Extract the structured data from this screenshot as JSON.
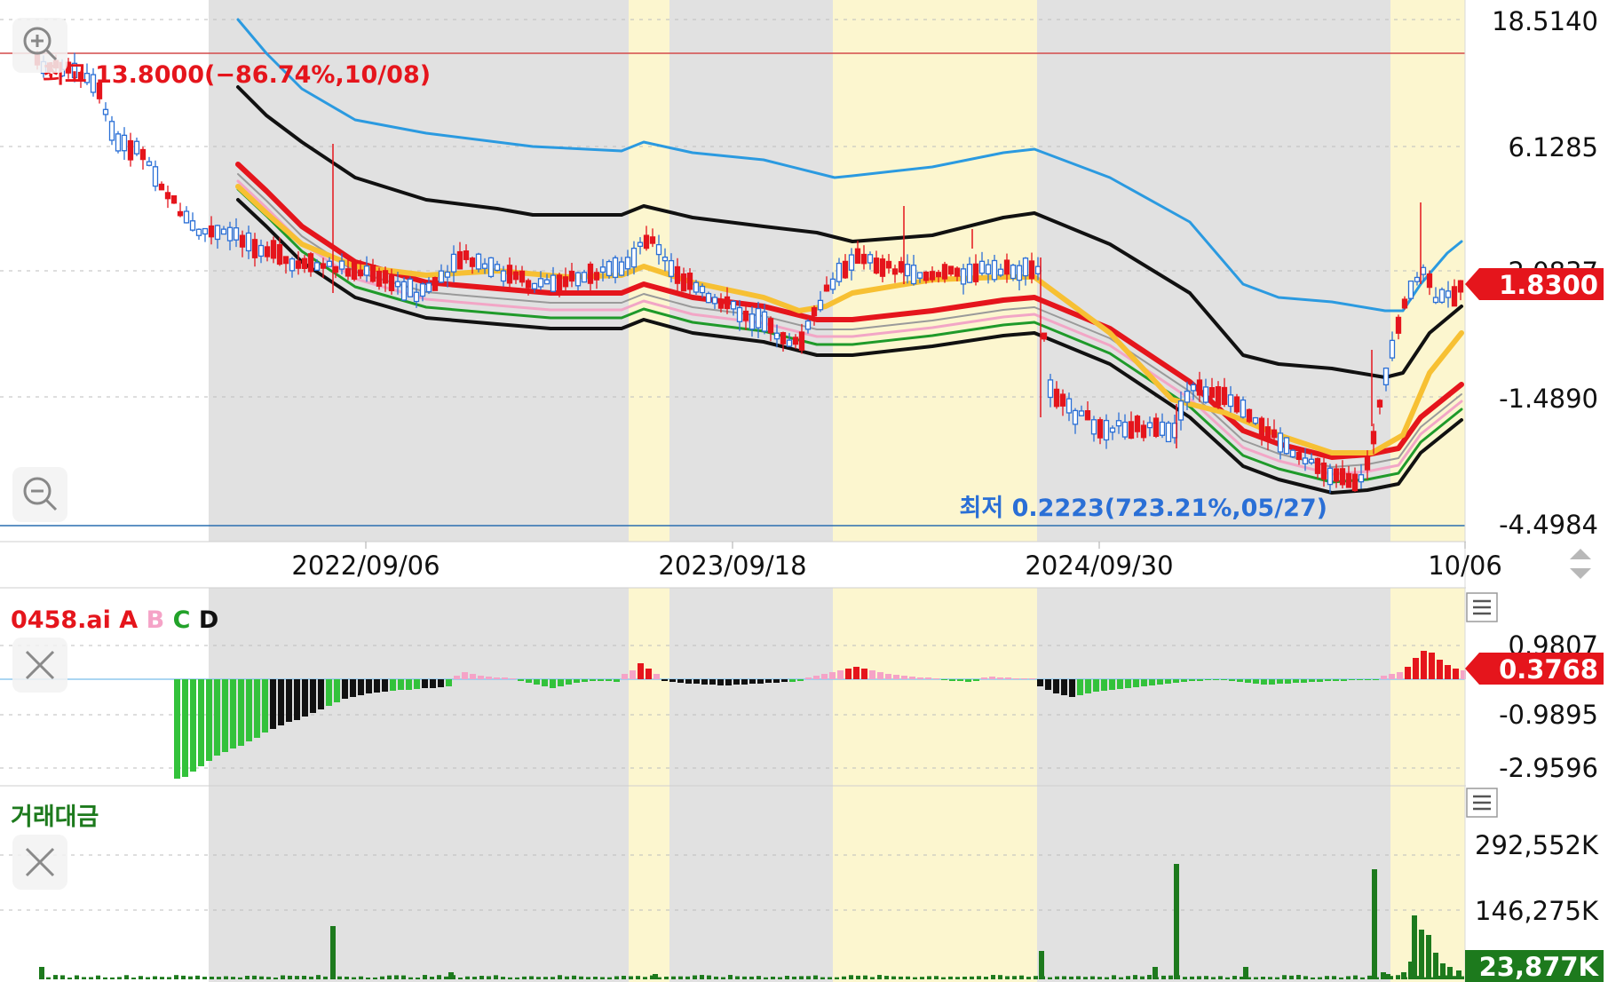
{
  "main_panel": {
    "price_axis": [
      "18.5140",
      "6.1285",
      "2.0837",
      "-1.4890",
      "-4.4984"
    ],
    "current_price": "1.8300",
    "high_annotation": "최고 13.8000(−86.74%,10/08)",
    "low_annotation": "최저 0.2223(723.21%,05/27)",
    "zoom_in": "zoom-in",
    "zoom_out": "zoom-out",
    "date_axis": [
      "2022/09/06",
      "2023/09/18",
      "2024/09/30",
      "10/06"
    ],
    "colors": {
      "up": "#e5151c",
      "down": "#2a6fd6",
      "band_upper": "#2b9ae0",
      "band_black": "#111111",
      "avg_yellow": "#f7c033",
      "shade_gray": "#e1e1e1",
      "shade_yellow": "#fcf6cf",
      "high_line": "#d44a4a",
      "low_line": "#2a6fb0"
    }
  },
  "indicator_panel": {
    "title_parts": [
      {
        "text": "0458.ai A",
        "color": "#e5151c"
      },
      {
        "text": "B",
        "color": "#f5a3c7"
      },
      {
        "text": "C",
        "color": "#22a22a"
      },
      {
        "text": "D",
        "color": "#111111"
      }
    ],
    "axis": [
      "0.9807",
      "-0.9895",
      "-2.9596"
    ],
    "current_value": "0.3768"
  },
  "volume_panel": {
    "title": "거래대금",
    "axis": [
      "292,552K",
      "146,275K"
    ],
    "current_value": "23,877K"
  }
}
